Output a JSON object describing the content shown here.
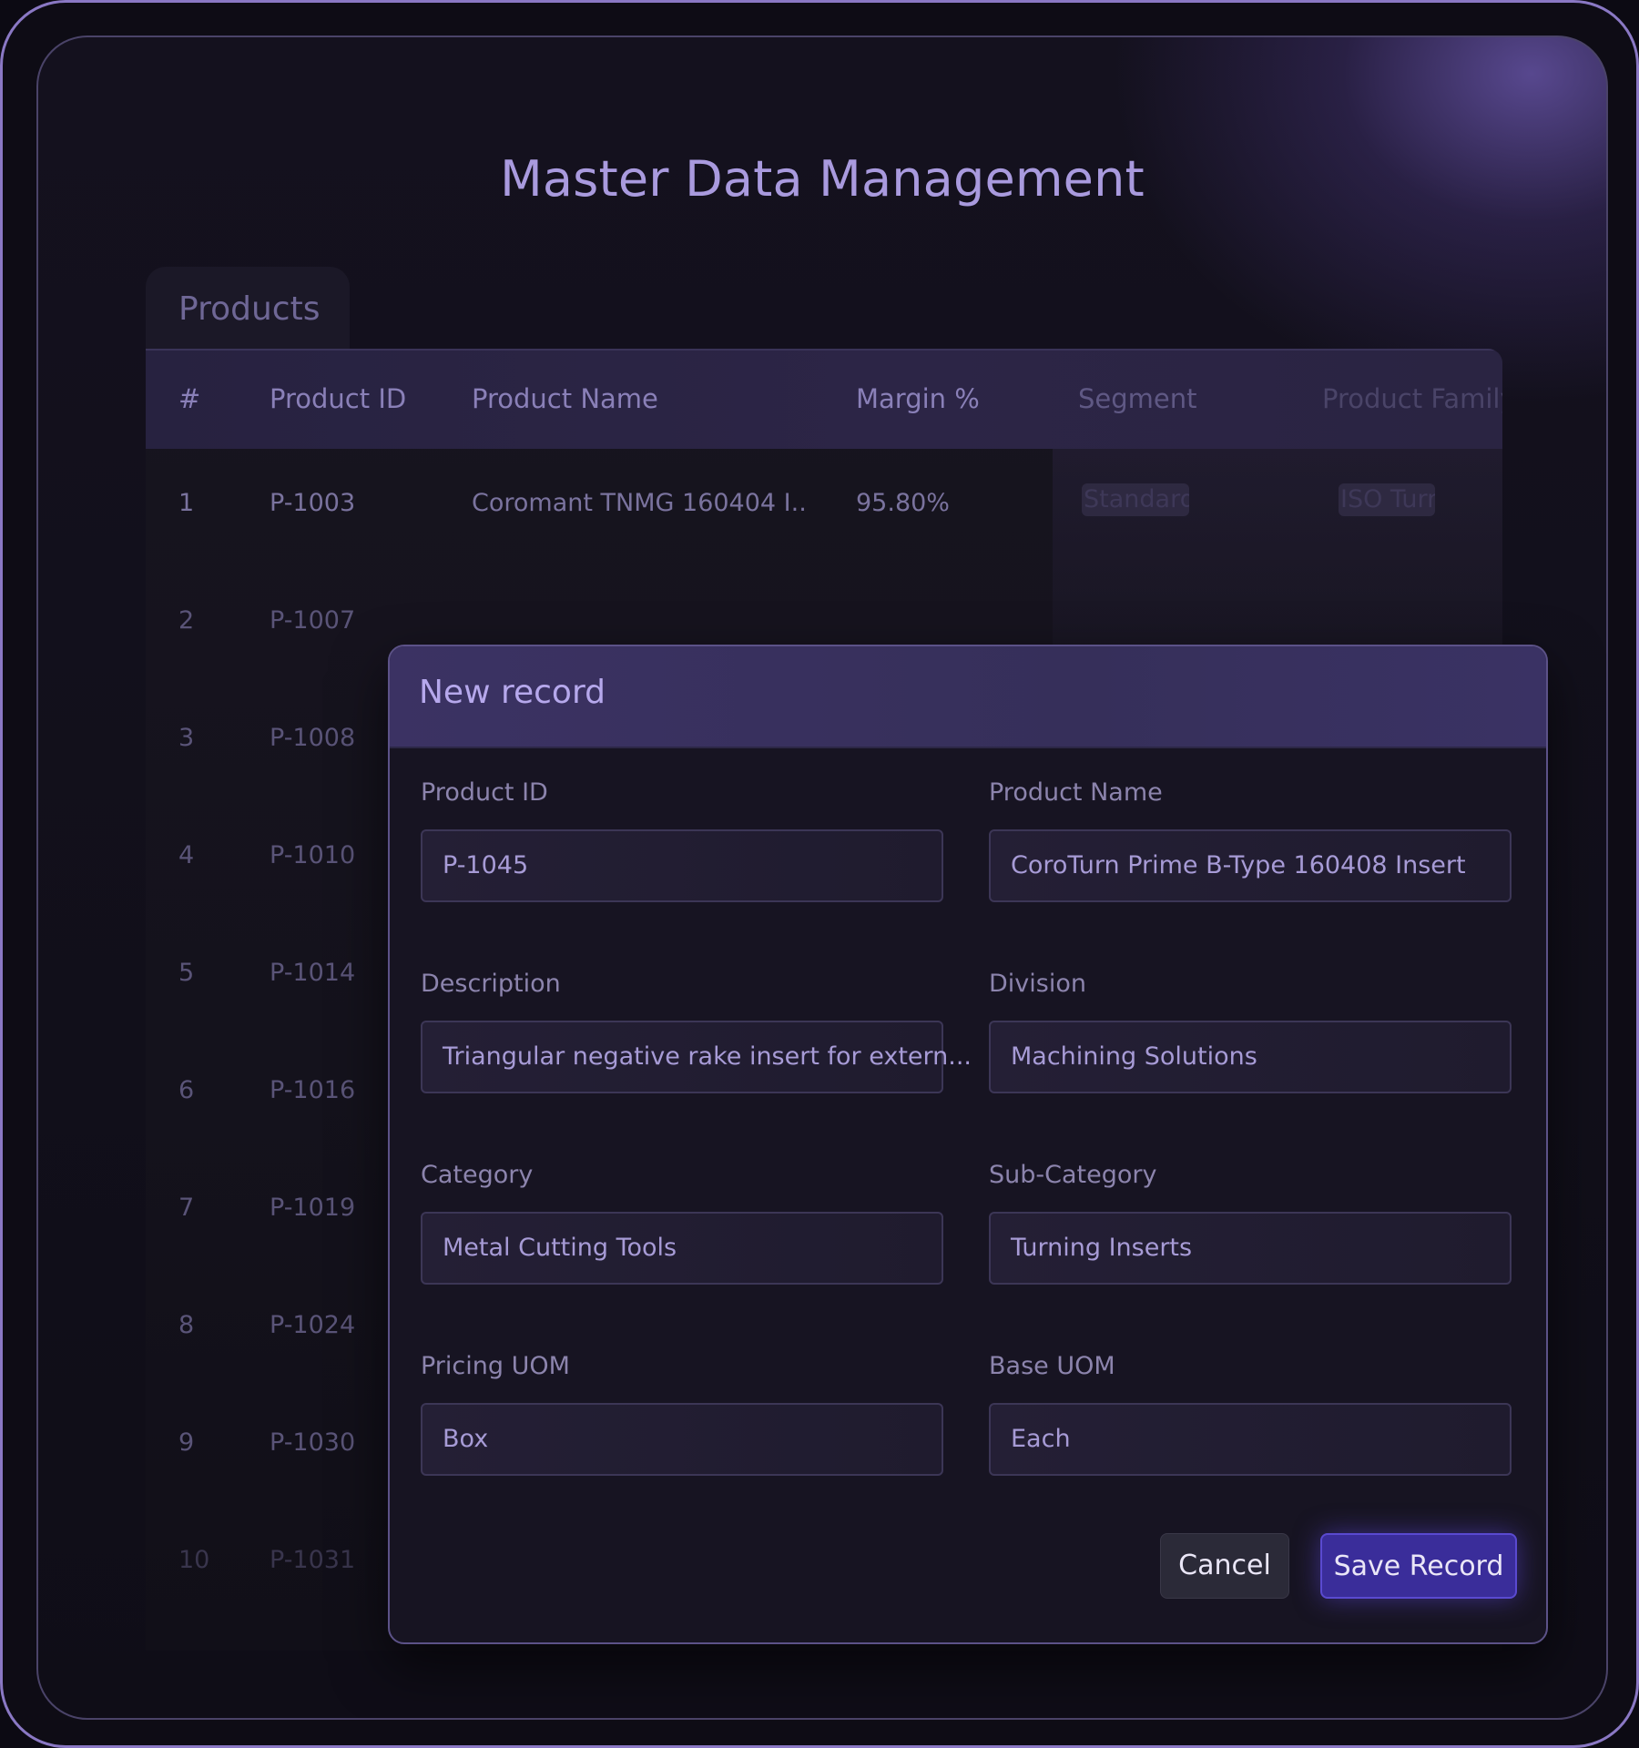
{
  "page": {
    "title": "Master Data Management"
  },
  "table": {
    "tab_label": "Products",
    "columns": [
      "#",
      "Product ID",
      "Product Name",
      "Margin %",
      "Segment",
      "Product Family"
    ],
    "rows": [
      {
        "num": "1",
        "product_id": "P-1003",
        "product_name": "Coromant TNMG 160404 I..",
        "margin": "95.80%",
        "segment": "Standard",
        "family": "ISO Turning"
      },
      {
        "num": "2",
        "product_id": "P-1007"
      },
      {
        "num": "3",
        "product_id": "P-1008"
      },
      {
        "num": "4",
        "product_id": "P-1010"
      },
      {
        "num": "5",
        "product_id": "P-1014"
      },
      {
        "num": "6",
        "product_id": "P-1016"
      },
      {
        "num": "7",
        "product_id": "P-1019"
      },
      {
        "num": "8",
        "product_id": "P-1024"
      },
      {
        "num": "9",
        "product_id": "P-1030"
      },
      {
        "num": "10",
        "product_id": "P-1031"
      }
    ]
  },
  "modal": {
    "title": "New record",
    "fields": [
      {
        "label": "Product ID",
        "value": "P-1045"
      },
      {
        "label": "Product Name",
        "value": "CoroTurn Prime B-Type 160408 Insert"
      },
      {
        "label": "Description",
        "value": "Triangular negative rake insert for extern..."
      },
      {
        "label": "Division",
        "value": "Machining Solutions"
      },
      {
        "label": "Category",
        "value": "Metal Cutting Tools"
      },
      {
        "label": "Sub-Category",
        "value": "Turning Inserts"
      },
      {
        "label": "Pricing UOM",
        "value": "Box"
      },
      {
        "label": "Base UOM",
        "value": "Each"
      }
    ],
    "cancel_label": "Cancel",
    "save_label": "Save Record"
  },
  "colors": {
    "accent": "#3a2d9a",
    "title": "#a99ade",
    "header_bg": "#2c2546"
  }
}
